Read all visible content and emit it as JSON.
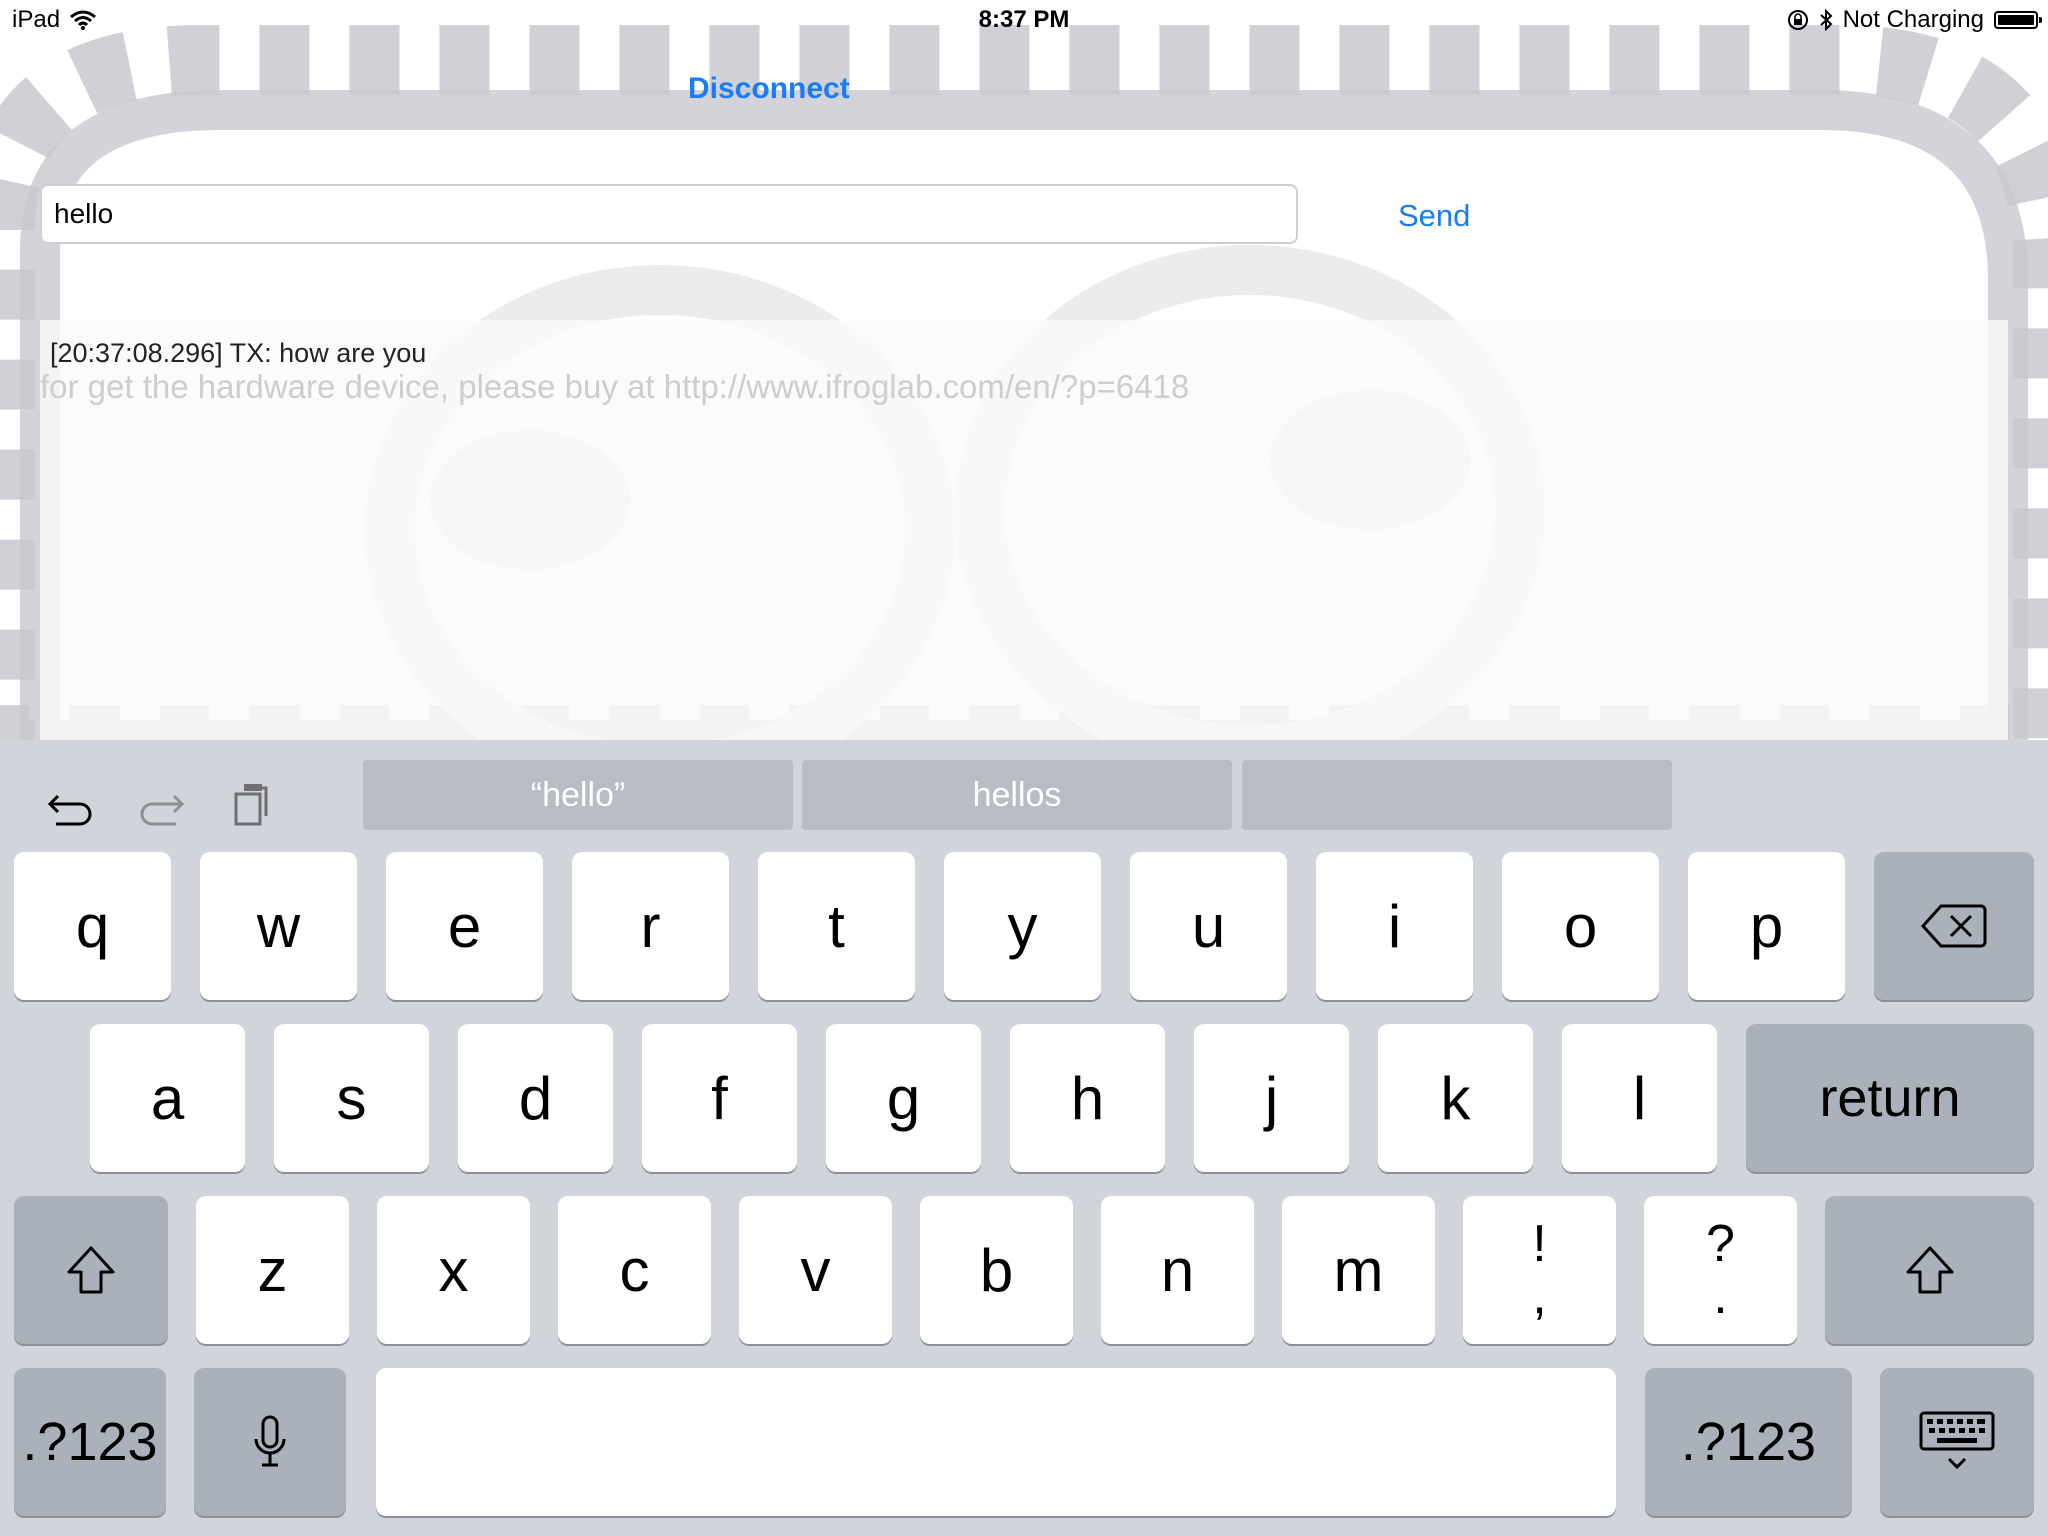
{
  "status_bar": {
    "device": "iPad",
    "time": "8:37 PM",
    "charging": "Not Charging"
  },
  "app": {
    "disconnect_label": "Disconnect",
    "message_value": "hello",
    "send_label": "Send",
    "log_line": "[20:37:08.296] TX: how are you",
    "hint_line": "for get the hardware device, please buy at http://www.ifroglab.com/en/?p=6418"
  },
  "keyboard": {
    "suggestions": [
      "“hello”",
      "hellos",
      ""
    ],
    "row1": [
      "q",
      "w",
      "e",
      "r",
      "t",
      "y",
      "u",
      "i",
      "o",
      "p"
    ],
    "row2": [
      "a",
      "s",
      "d",
      "f",
      "g",
      "h",
      "j",
      "k",
      "l"
    ],
    "row3": [
      "z",
      "x",
      "c",
      "v",
      "b",
      "n",
      "m"
    ],
    "punct1": {
      "top": "!",
      "bottom": ","
    },
    "punct2": {
      "top": "?",
      "bottom": "."
    },
    "return_label": "return",
    "numbers_label": ".?123"
  },
  "colors": {
    "accent": "#1a7cf5",
    "keyboard_bg": "#d1d4da",
    "key_dark": "#abb1ba"
  }
}
